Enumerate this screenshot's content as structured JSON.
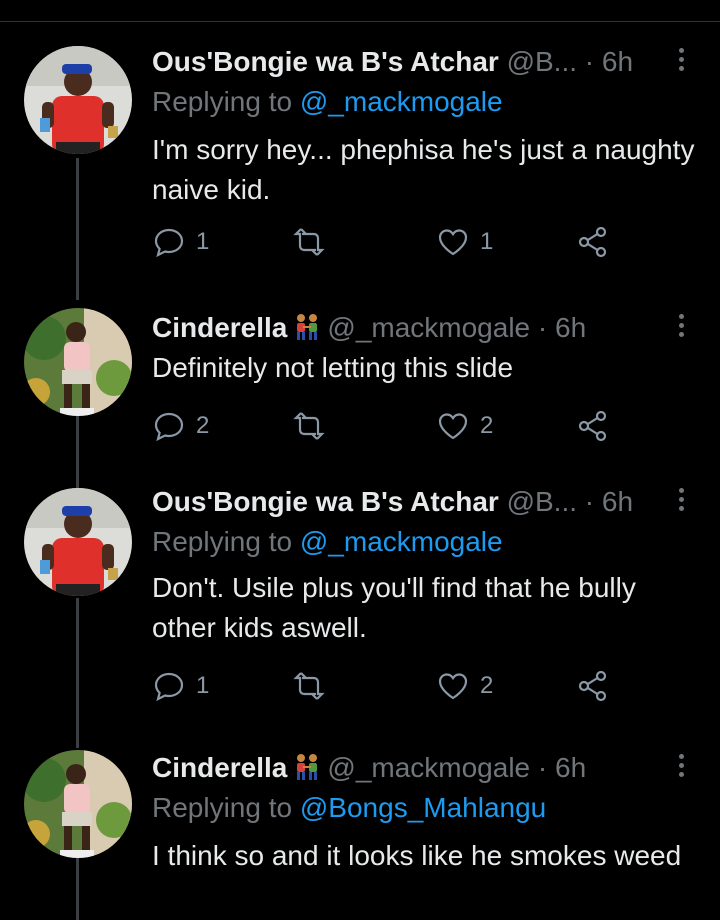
{
  "tweets": [
    {
      "name": "Ous'Bongie wa B's Atchar",
      "handle": "@B...",
      "dot": "·",
      "time": "6h",
      "replying_prefix": "Replying to ",
      "replying_to": "@_mackmogale",
      "text": "I'm sorry hey... phephisa he's just a naughty naive kid.",
      "replies": "1",
      "retweets": "",
      "likes": "1",
      "avatar": "red-shirt-person"
    },
    {
      "name": "Cinderella",
      "emoji": "people-holding-hands-emoji",
      "handle": "@_mackmogale",
      "dot": "·",
      "time": "6h",
      "text": "Definitely not letting this slide",
      "replies": "2",
      "retweets": "",
      "likes": "2",
      "avatar": "garden-person"
    },
    {
      "name": "Ous'Bongie wa B's Atchar",
      "handle": "@B...",
      "dot": "·",
      "time": "6h",
      "replying_prefix": "Replying to ",
      "replying_to": "@_mackmogale",
      "text": "Don't. Usile plus you'll find that he bully other kids aswell.",
      "replies": "1",
      "retweets": "",
      "likes": "2",
      "avatar": "red-shirt-person"
    },
    {
      "name": "Cinderella",
      "emoji": "people-holding-hands-emoji",
      "handle": "@_mackmogale",
      "dot": "·",
      "time": "6h",
      "replying_prefix": "Replying to ",
      "replying_to": "@Bongs_Mahlangu",
      "text": "I think so and it looks like he smokes weed",
      "avatar": "garden-person"
    }
  ],
  "colors": {
    "background": "#000000",
    "link": "#1d9bf0",
    "secondary_text": "#71767b",
    "thread_line": "#3b3e42"
  }
}
